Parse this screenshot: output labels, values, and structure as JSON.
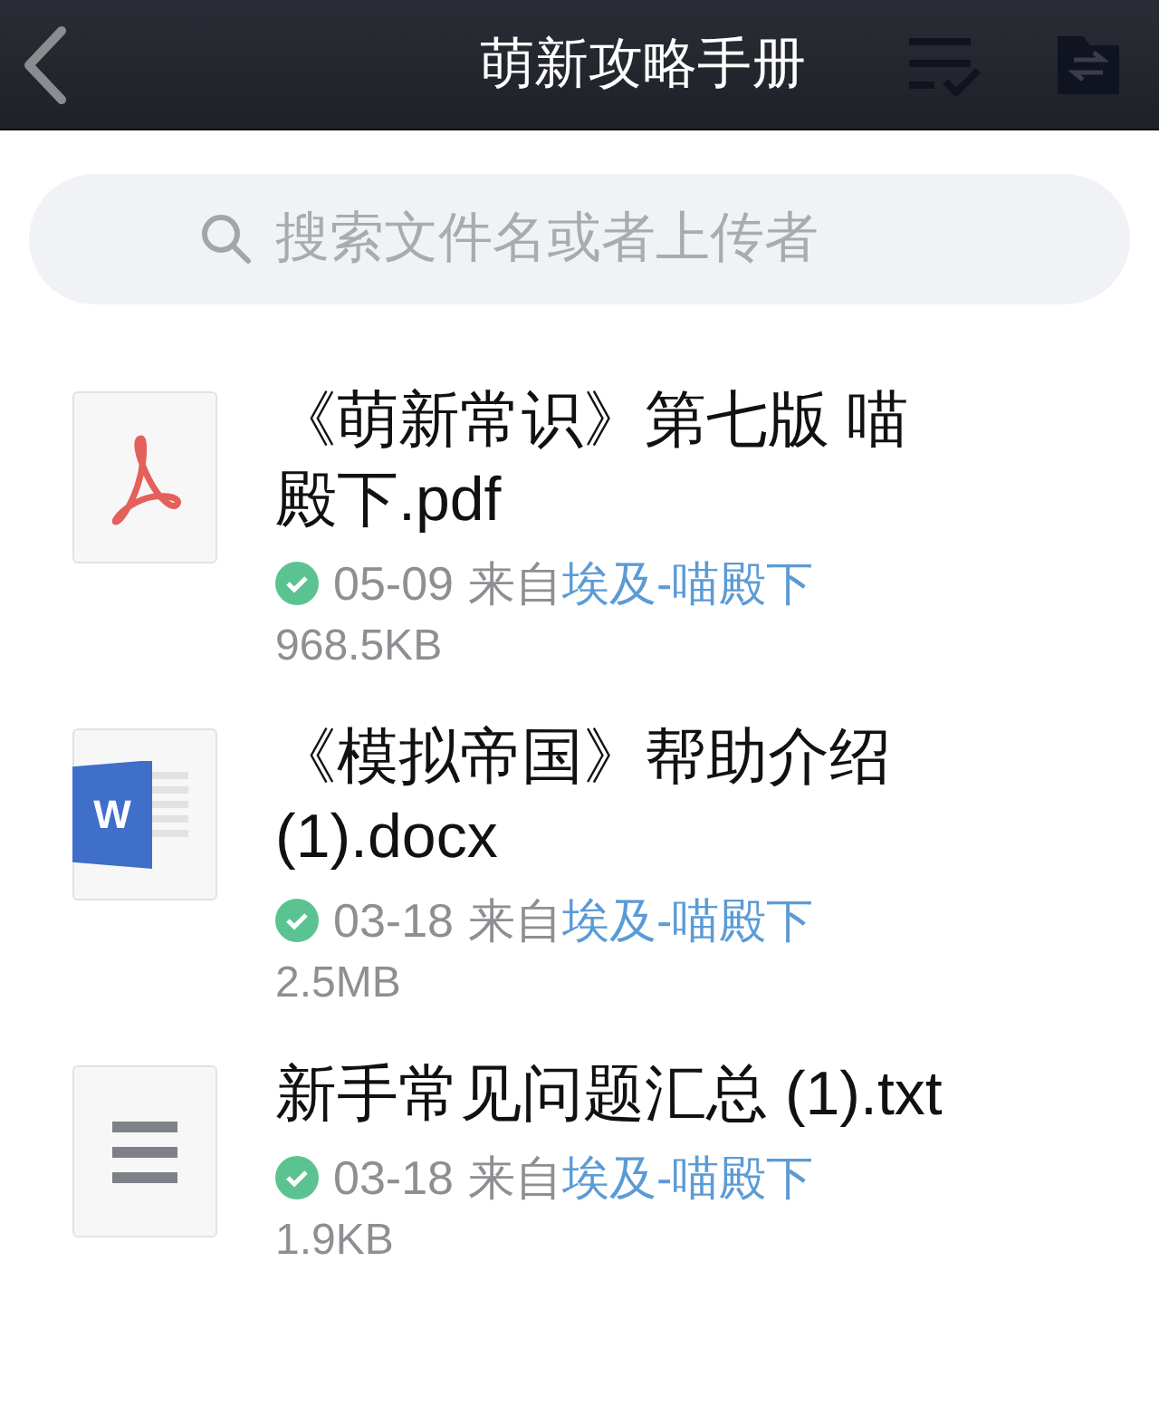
{
  "header": {
    "title": "萌新攻略手册"
  },
  "search": {
    "placeholder": "搜索文件名或者上传者"
  },
  "files": [
    {
      "kind": "pdf",
      "name": "《萌新常识》第七版 喵殿下.pdf",
      "verified": true,
      "date": "05-09",
      "from_label": "来自",
      "uploader": "埃及-喵殿下",
      "size": "968.5KB"
    },
    {
      "kind": "docx",
      "icon_letter": "W",
      "name": "《模拟帝国》帮助介绍(1).docx",
      "verified": true,
      "date": "03-18",
      "from_label": "来自",
      "uploader": "埃及-喵殿下",
      "size": "2.5MB"
    },
    {
      "kind": "txt",
      "name": "新手常见问题汇总 (1).txt",
      "verified": true,
      "date": "03-18",
      "from_label": "来自",
      "uploader": "埃及-喵殿下",
      "size": "1.9KB"
    }
  ]
}
